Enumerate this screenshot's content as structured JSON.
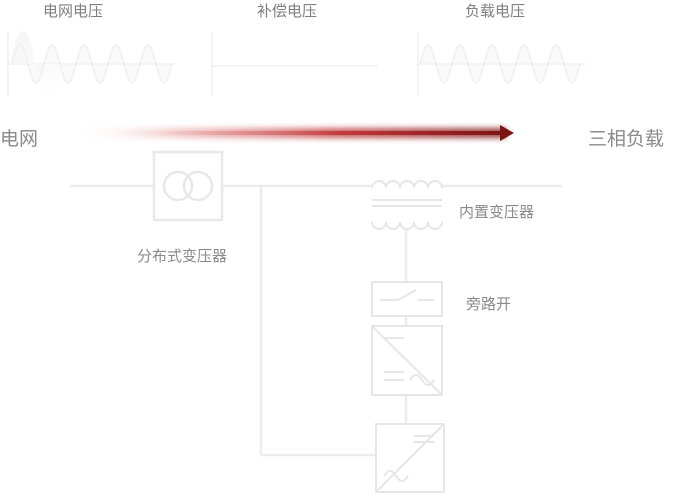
{
  "waveforms": {
    "grid_voltage": "电网电压",
    "compensation_voltage": "补偿电压",
    "load_voltage": "负载电压"
  },
  "flow": {
    "source": "电网",
    "target": "三相负载"
  },
  "components": {
    "distributed_transformer": "分布式变压器",
    "internal_transformer": "内置变压器",
    "bypass_switch": "旁路开"
  },
  "colors": {
    "arrow": "#8b1a1a",
    "line": "#ececec",
    "text": "#7f7f7f"
  }
}
